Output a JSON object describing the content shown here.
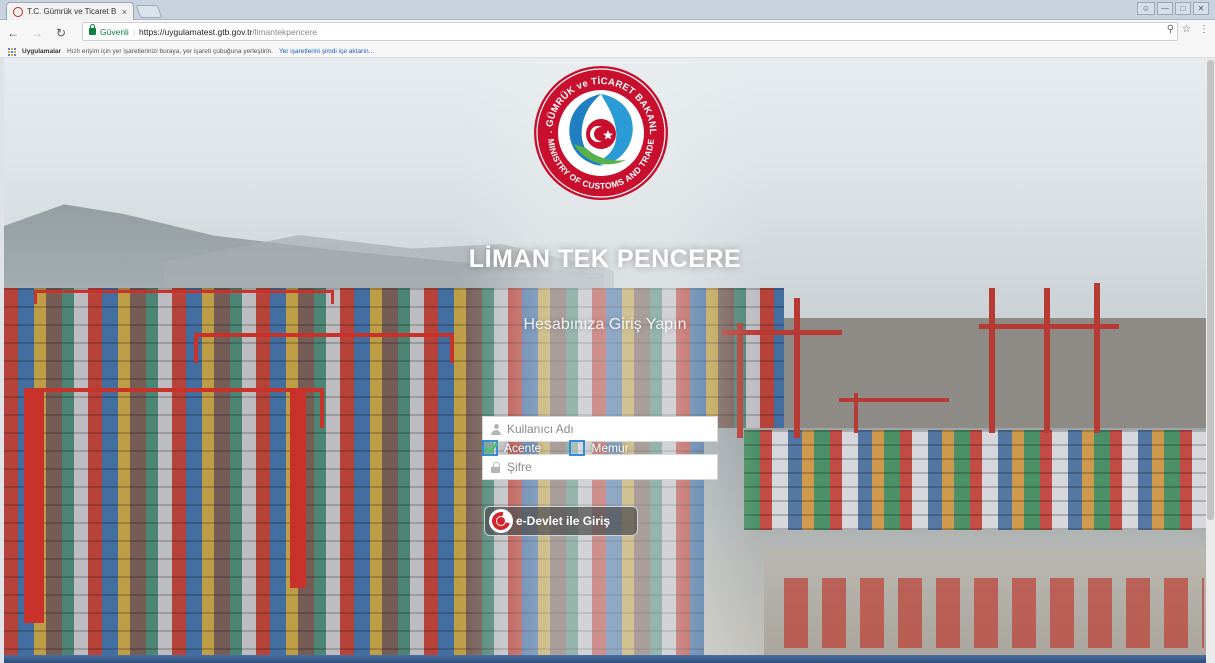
{
  "browser": {
    "tab_title": "T.C. Gümrük ve Ticaret B",
    "tab_close": "×",
    "secure_label": "Güvenli",
    "url_host": "https://uygulamatest.gtb.gov.tr",
    "url_path": "/limantekpencere",
    "zoom_icon": "zoom-icon",
    "star_icon": "bookmark-star-icon",
    "menu_icon": "menu-icon"
  },
  "bookmarks_bar": {
    "apps_label": "Uygulamalar",
    "hint_text": "Hızlı erişim için yer işaretlerinizi buraya, yer işareti çubuğuna yerleştirin.",
    "import_link": "Yer işaretlerini şimdi içe aktarın..."
  },
  "logo": {
    "top_text": "T.C. GÜMRÜK ve TİCARET BAKANLIĞI",
    "bottom_text": "MINISTRY OF CUSTOMS AND TRADE"
  },
  "login": {
    "app_title": "LİMAN TEK PENCERE",
    "subtitle": "Hesabınıza Giriş Yapın",
    "username_placeholder": "Kullanıcı Adı",
    "password_placeholder": "Şifre",
    "roles": [
      {
        "label": "Acente",
        "checked": true
      },
      {
        "label": "Memur",
        "checked": false
      }
    ],
    "edevlet_label": "e-Devlet ile Giriş"
  },
  "colors": {
    "logo_red": "#c8102e",
    "accent_blue": "#3a8bd6",
    "check_green": "#4cc36a"
  }
}
